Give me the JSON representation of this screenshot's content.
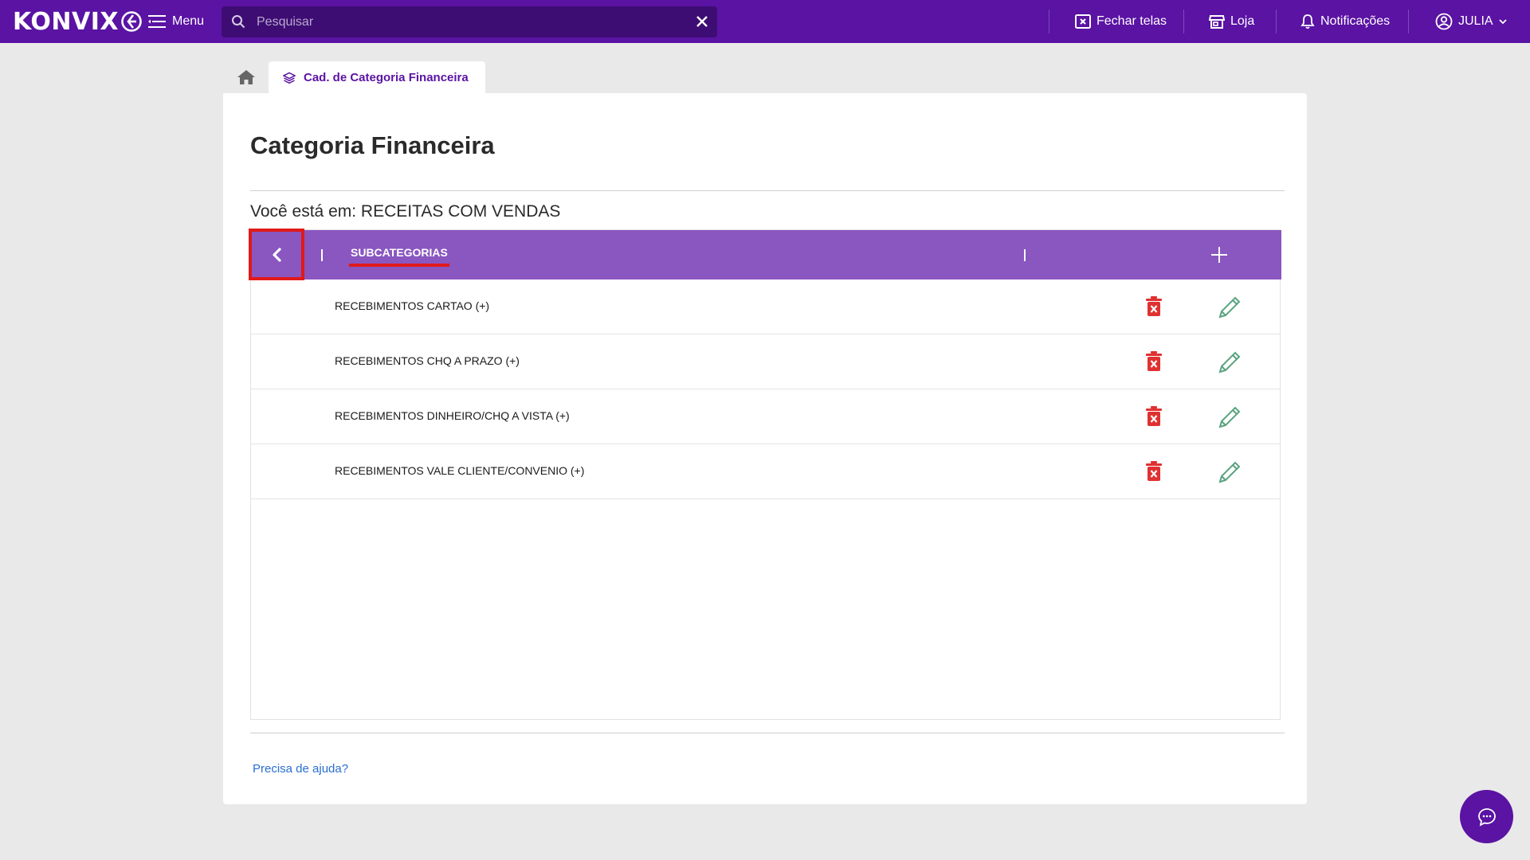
{
  "header": {
    "logo_text": "KONVIX",
    "menu_label": "Menu",
    "search_placeholder": "Pesquisar",
    "nav": {
      "close_screens": "Fechar telas",
      "store": "Loja",
      "notifications": "Notificações",
      "user": "JULIA"
    },
    "icons": [
      "menu-icon",
      "search-icon",
      "close-icon",
      "close-window-icon",
      "store-icon",
      "bell-icon",
      "user-circle-icon",
      "chevron-down-icon"
    ]
  },
  "tabs": {
    "active_label": "Cad. de Categoria Financeira"
  },
  "page": {
    "title": "Categoria Financeira",
    "location_prefix": "Você está em:",
    "location_value": "RECEITAS COM VENDAS"
  },
  "grid": {
    "header_tab": "SUBCATEGORIAS",
    "rows": [
      {
        "label": "RECEBIMENTOS CARTAO (+)"
      },
      {
        "label": "RECEBIMENTOS CHQ A PRAZO (+)"
      },
      {
        "label": "RECEBIMENTOS DINHEIRO/CHQ A VISTA (+)"
      },
      {
        "label": "RECEBIMENTOS VALE CLIENTE/CONVENIO (+)"
      }
    ]
  },
  "footer": {
    "help_link": "Precisa de ajuda?"
  },
  "colors": {
    "topbar": "#5a13a3",
    "grid_header": "#8a56c0",
    "delete": "#e03131",
    "edit": "#5aa37f",
    "highlight": "#e11919"
  }
}
